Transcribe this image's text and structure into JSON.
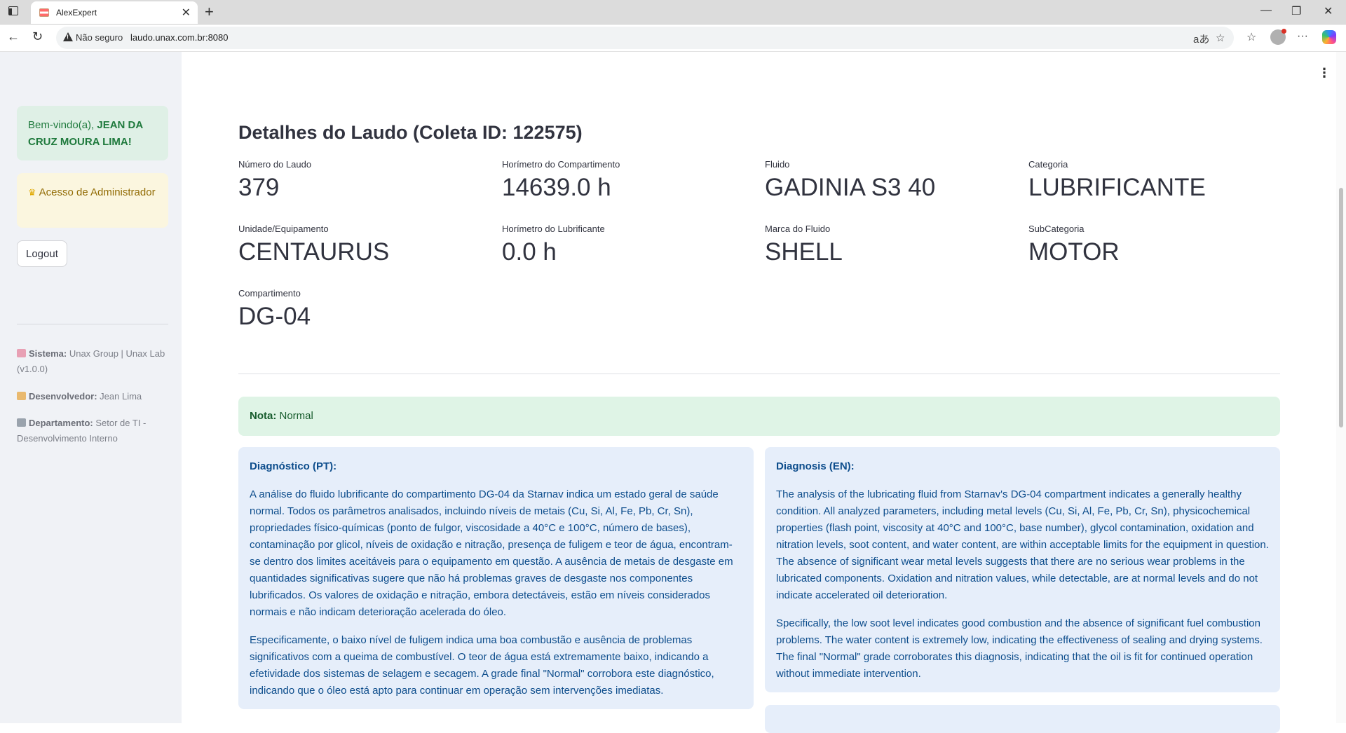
{
  "browser": {
    "tab_title": "AlexExpert",
    "not_secure": "Não seguro",
    "url": "laudo.unax.com.br:8080"
  },
  "sidebar": {
    "welcome_prefix": "Bem-vindo(a), ",
    "welcome_name": "JEAN DA CRUZ MOURA LIMA",
    "welcome_suffix": "!",
    "admin_label": "Acesso de Administrador",
    "logout_label": "Logout",
    "info": [
      {
        "label": "Sistema:",
        "value": "Unax Group | Unax Lab (v1.0.0)",
        "icon": "satellite-icon"
      },
      {
        "label": "Desenvolvedor:",
        "value": "Jean Lima",
        "icon": "developer-icon"
      },
      {
        "label": "Departamento:",
        "value": "Setor de TI - Desenvolvimento Interno",
        "icon": "building-icon"
      }
    ]
  },
  "report": {
    "title": "Detalhes do Laudo (Coleta ID: 122575)",
    "metrics": [
      {
        "label": "Número do Laudo",
        "value": "379"
      },
      {
        "label": "Horímetro do Compartimento",
        "value": "14639.0 h"
      },
      {
        "label": "Fluido",
        "value": "GADINIA S3 40"
      },
      {
        "label": "Categoria",
        "value": "LUBRIFICANTE"
      },
      {
        "label": "Unidade/Equipamento",
        "value": "CENTAURUS"
      },
      {
        "label": "Horímetro do Lubrificante",
        "value": "0.0 h"
      },
      {
        "label": "Marca do Fluido",
        "value": "SHELL"
      },
      {
        "label": "SubCategoria",
        "value": "MOTOR"
      },
      {
        "label": "Compartimento",
        "value": "DG-04"
      }
    ],
    "nota_label": "Nota:",
    "nota_value": "Normal",
    "diagnosis_pt": {
      "title": "Diagnóstico (PT):",
      "paragraphs": [
        "A análise do fluido lubrificante do compartimento DG-04 da Starnav indica um estado geral de saúde normal. Todos os parâmetros analisados, incluindo níveis de metais (Cu, Si, Al, Fe, Pb, Cr, Sn), propriedades físico-químicas (ponto de fulgor, viscosidade a 40°C e 100°C, número de bases), contaminação por glicol, níveis de oxidação e nitração, presença de fuligem e teor de água, encontram-se dentro dos limites aceitáveis para o equipamento em questão. A ausência de metais de desgaste em quantidades significativas sugere que não há problemas graves de desgaste nos componentes lubrificados. Os valores de oxidação e nitração, embora detectáveis, estão em níveis considerados normais e não indicam deterioração acelerada do óleo.",
        "Especificamente, o baixo nível de fuligem indica uma boa combustão e ausência de problemas significativos com a queima de combustível. O teor de água está extremamente baixo, indicando a efetividade dos sistemas de selagem e secagem. A grade final \"Normal\" corrobora este diagnóstico, indicando que o óleo está apto para continuar em operação sem intervenções imediatas."
      ]
    },
    "diagnosis_en": {
      "title": "Diagnosis (EN):",
      "paragraphs": [
        "The analysis of the lubricating fluid from Starnav's DG-04 compartment indicates a generally healthy condition. All analyzed parameters, including metal levels (Cu, Si, Al, Fe, Pb, Cr, Sn), physicochemical properties (flash point, viscosity at 40°C and 100°C, base number), glycol contamination, oxidation and nitration levels, soot content, and water content, are within acceptable limits for the equipment in question. The absence of significant wear metal levels suggests that there are no serious wear problems in the lubricated components. Oxidation and nitration values, while detectable, are at normal levels and do not indicate accelerated oil deterioration.",
        "Specifically, the low soot level indicates good combustion and the absence of significant fuel combustion problems. The water content is extremely low, indicating the effectiveness of sealing and drying systems. The final \"Normal\" grade corroborates this diagnosis, indicating that the oil is fit for continued operation without immediate intervention."
      ]
    }
  },
  "colors": {
    "sidebar_bg": "#f0f2f6",
    "success_bg": "#dff0e6",
    "warning_bg": "#fbf6df",
    "info_bg": "#e6eefa"
  }
}
